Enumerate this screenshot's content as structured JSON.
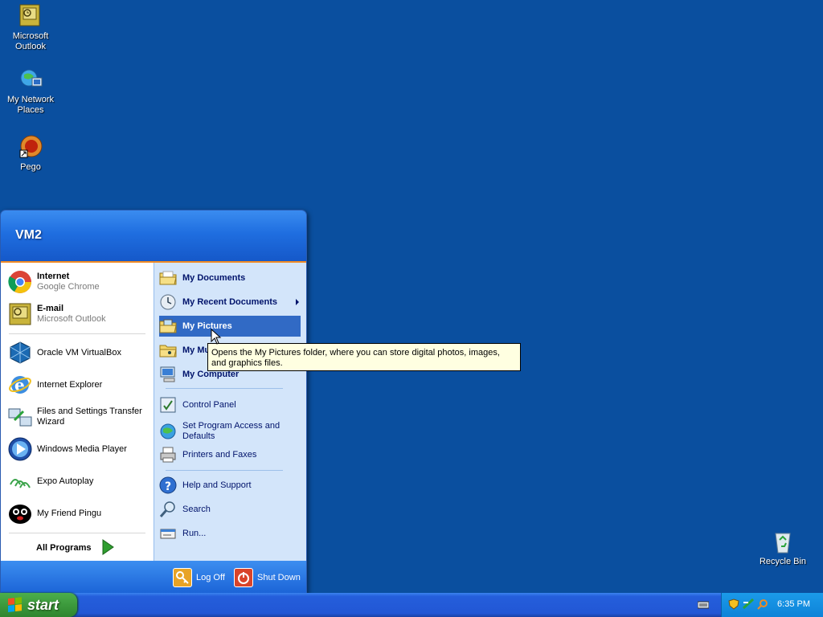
{
  "desktop": {
    "icons": [
      {
        "label": "Microsoft Outlook"
      },
      {
        "label": "My Network Places"
      },
      {
        "label": "Pego"
      },
      {
        "label": "Recycle Bin"
      }
    ]
  },
  "start_menu": {
    "user": "VM2",
    "pinned": [
      {
        "title": "Internet",
        "subtitle": "Google Chrome"
      },
      {
        "title": "E-mail",
        "subtitle": "Microsoft Outlook"
      }
    ],
    "recent": [
      {
        "label": "Oracle VM VirtualBox"
      },
      {
        "label": "Internet Explorer"
      },
      {
        "label": "Files and Settings Transfer Wizard"
      },
      {
        "label": "Windows Media Player"
      },
      {
        "label": "Expo Autoplay"
      },
      {
        "label": "My Friend Pingu"
      }
    ],
    "all_programs": "All Programs",
    "right_items": [
      {
        "label": "My Documents"
      },
      {
        "label": "My Recent Documents"
      },
      {
        "label": "My Pictures"
      },
      {
        "label": "My Music"
      },
      {
        "label": "My Computer"
      },
      {
        "label": "Control Panel"
      },
      {
        "label": "Set Program Access and Defaults"
      },
      {
        "label": "Printers and Faxes"
      },
      {
        "label": "Help and Support"
      },
      {
        "label": "Search"
      },
      {
        "label": "Run..."
      }
    ],
    "log_off": "Log Off",
    "shut_down": "Shut Down"
  },
  "tooltip": {
    "text": "Opens the My Pictures folder, where you can store digital photos, images, and graphics files."
  },
  "taskbar": {
    "start_label": "start",
    "clock": "6:35 PM"
  }
}
